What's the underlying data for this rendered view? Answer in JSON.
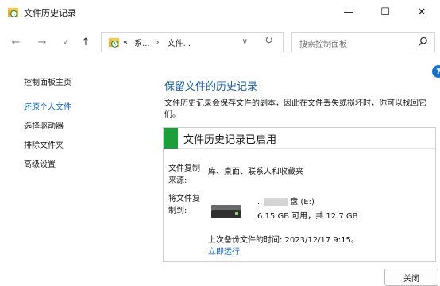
{
  "window": {
    "title": "文件历史记录",
    "controls": {
      "minimize": "—",
      "maximize": "☐",
      "close": "✕"
    }
  },
  "navbar": {
    "back": "←",
    "forward": "→",
    "recent": "∨",
    "up": "↑",
    "breadcrumb": {
      "prefix": "«",
      "part1": "系...",
      "sep": "›",
      "part2": "文件..."
    },
    "dropdown": "∨",
    "refresh": "↻",
    "search_placeholder": "搜索控制面板"
  },
  "help": {
    "label": "?"
  },
  "sidebar": {
    "home": "控制面板主页",
    "links": [
      "还原个人文件",
      "选择驱动器",
      "排除文件夹",
      "高级设置"
    ]
  },
  "main": {
    "title": "保留文件的历史记录",
    "description": "文件历史记录会保存文件的副本，因此在文件丢失或损坏时，你可以找回它们。"
  },
  "panel": {
    "status": "文件历史记录已启用",
    "sources_label": "文件复制来源:",
    "sources_value": "库、桌面、联系人和收藏夹",
    "target_label": "将文件复制到:",
    "drive_name_prefix": ".",
    "drive_name": "盘 (E:)",
    "drive_space": "6.15 GB 可用，共 12.7 GB",
    "last_backup": "上次备份文件的时间: 2023/12/17 9:15。",
    "run_now": "立即运行"
  },
  "footer": {
    "close_label": "关闭"
  },
  "colors": {
    "accent": "#0b62c9",
    "title_blue": "#1a5fa6",
    "status_green": "#1e9d3b"
  }
}
